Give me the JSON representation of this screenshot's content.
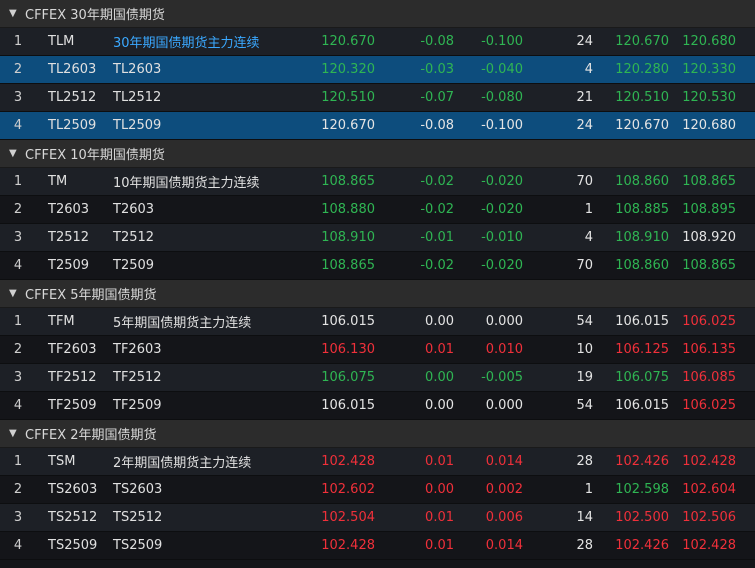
{
  "colors": {
    "up": "#f0303a",
    "down": "#2fb553",
    "flat": "#e4e4e4",
    "link": "#3aa8ff",
    "selected": "#0d4d7d"
  },
  "groups": [
    {
      "title": "CFFEX 30年期国债期货",
      "rows": [
        {
          "idx": "1",
          "code": "TLM",
          "name": "30年期国债期货主力连续",
          "name_style": "link",
          "last": "120.670",
          "last_c": "down",
          "chg": "-0.08",
          "chg_c": "down",
          "pct": "-0.100",
          "pct_c": "down",
          "vol": "24",
          "bid": "120.670",
          "bid_c": "down",
          "ask": "120.680",
          "ask_c": "down"
        },
        {
          "idx": "2",
          "code": "TL2603",
          "name": "TL2603",
          "selected": true,
          "last": "120.320",
          "last_c": "down",
          "chg": "-0.03",
          "chg_c": "down",
          "pct": "-0.040",
          "pct_c": "down",
          "vol": "4",
          "bid": "120.280",
          "bid_c": "down",
          "ask": "120.330",
          "ask_c": "down"
        },
        {
          "idx": "3",
          "code": "TL2512",
          "name": "TL2512",
          "last": "120.510",
          "last_c": "down",
          "chg": "-0.07",
          "chg_c": "down",
          "pct": "-0.080",
          "pct_c": "down",
          "vol": "21",
          "bid": "120.510",
          "bid_c": "down",
          "ask": "120.530",
          "ask_c": "down"
        },
        {
          "idx": "4",
          "code": "TL2509",
          "name": "TL2509",
          "selected": true,
          "last": "120.670",
          "last_c": "flat",
          "chg": "-0.08",
          "chg_c": "flat",
          "pct": "-0.100",
          "pct_c": "flat",
          "vol": "24",
          "bid": "120.670",
          "bid_c": "flat",
          "ask": "120.680",
          "ask_c": "flat"
        }
      ]
    },
    {
      "title": "CFFEX 10年期国债期货",
      "rows": [
        {
          "idx": "1",
          "code": "TM",
          "name": "10年期国债期货主力连续",
          "last": "108.865",
          "last_c": "down",
          "chg": "-0.02",
          "chg_c": "down",
          "pct": "-0.020",
          "pct_c": "down",
          "vol": "70",
          "bid": "108.860",
          "bid_c": "down",
          "ask": "108.865",
          "ask_c": "down"
        },
        {
          "idx": "2",
          "code": "T2603",
          "name": "T2603",
          "last": "108.880",
          "last_c": "down",
          "chg": "-0.02",
          "chg_c": "down",
          "pct": "-0.020",
          "pct_c": "down",
          "vol": "1",
          "bid": "108.885",
          "bid_c": "down",
          "ask": "108.895",
          "ask_c": "down"
        },
        {
          "idx": "3",
          "code": "T2512",
          "name": "T2512",
          "last": "108.910",
          "last_c": "down",
          "chg": "-0.01",
          "chg_c": "down",
          "pct": "-0.010",
          "pct_c": "down",
          "vol": "4",
          "bid": "108.910",
          "bid_c": "down",
          "ask": "108.920",
          "ask_c": "flat"
        },
        {
          "idx": "4",
          "code": "T2509",
          "name": "T2509",
          "last": "108.865",
          "last_c": "down",
          "chg": "-0.02",
          "chg_c": "down",
          "pct": "-0.020",
          "pct_c": "down",
          "vol": "70",
          "bid": "108.860",
          "bid_c": "down",
          "ask": "108.865",
          "ask_c": "down"
        }
      ]
    },
    {
      "title": "CFFEX 5年期国债期货",
      "rows": [
        {
          "idx": "1",
          "code": "TFM",
          "name": "5年期国债期货主力连续",
          "last": "106.015",
          "last_c": "flat",
          "chg": "0.00",
          "chg_c": "flat",
          "pct": "0.000",
          "pct_c": "flat",
          "vol": "54",
          "bid": "106.015",
          "bid_c": "flat",
          "ask": "106.025",
          "ask_c": "up"
        },
        {
          "idx": "2",
          "code": "TF2603",
          "name": "TF2603",
          "last": "106.130",
          "last_c": "up",
          "chg": "0.01",
          "chg_c": "up",
          "pct": "0.010",
          "pct_c": "up",
          "vol": "10",
          "bid": "106.125",
          "bid_c": "up",
          "ask": "106.135",
          "ask_c": "up"
        },
        {
          "idx": "3",
          "code": "TF2512",
          "name": "TF2512",
          "last": "106.075",
          "last_c": "down",
          "chg": "0.00",
          "chg_c": "down",
          "pct": "-0.005",
          "pct_c": "down",
          "vol": "19",
          "bid": "106.075",
          "bid_c": "down",
          "ask": "106.085",
          "ask_c": "up"
        },
        {
          "idx": "4",
          "code": "TF2509",
          "name": "TF2509",
          "last": "106.015",
          "last_c": "flat",
          "chg": "0.00",
          "chg_c": "flat",
          "pct": "0.000",
          "pct_c": "flat",
          "vol": "54",
          "bid": "106.015",
          "bid_c": "flat",
          "ask": "106.025",
          "ask_c": "up"
        }
      ]
    },
    {
      "title": "CFFEX 2年期国债期货",
      "rows": [
        {
          "idx": "1",
          "code": "TSM",
          "name": "2年期国债期货主力连续",
          "last": "102.428",
          "last_c": "up",
          "chg": "0.01",
          "chg_c": "up",
          "pct": "0.014",
          "pct_c": "up",
          "vol": "28",
          "bid": "102.426",
          "bid_c": "up",
          "ask": "102.428",
          "ask_c": "up"
        },
        {
          "idx": "2",
          "code": "TS2603",
          "name": "TS2603",
          "last": "102.602",
          "last_c": "up",
          "chg": "0.00",
          "chg_c": "up",
          "pct": "0.002",
          "pct_c": "up",
          "vol": "1",
          "bid": "102.598",
          "bid_c": "down",
          "ask": "102.604",
          "ask_c": "up"
        },
        {
          "idx": "3",
          "code": "TS2512",
          "name": "TS2512",
          "last": "102.504",
          "last_c": "up",
          "chg": "0.01",
          "chg_c": "up",
          "pct": "0.006",
          "pct_c": "up",
          "vol": "14",
          "bid": "102.500",
          "bid_c": "up",
          "ask": "102.506",
          "ask_c": "up"
        },
        {
          "idx": "4",
          "code": "TS2509",
          "name": "TS2509",
          "last": "102.428",
          "last_c": "up",
          "chg": "0.01",
          "chg_c": "up",
          "pct": "0.014",
          "pct_c": "up",
          "vol": "28",
          "bid": "102.426",
          "bid_c": "up",
          "ask": "102.428",
          "ask_c": "up"
        }
      ]
    }
  ]
}
